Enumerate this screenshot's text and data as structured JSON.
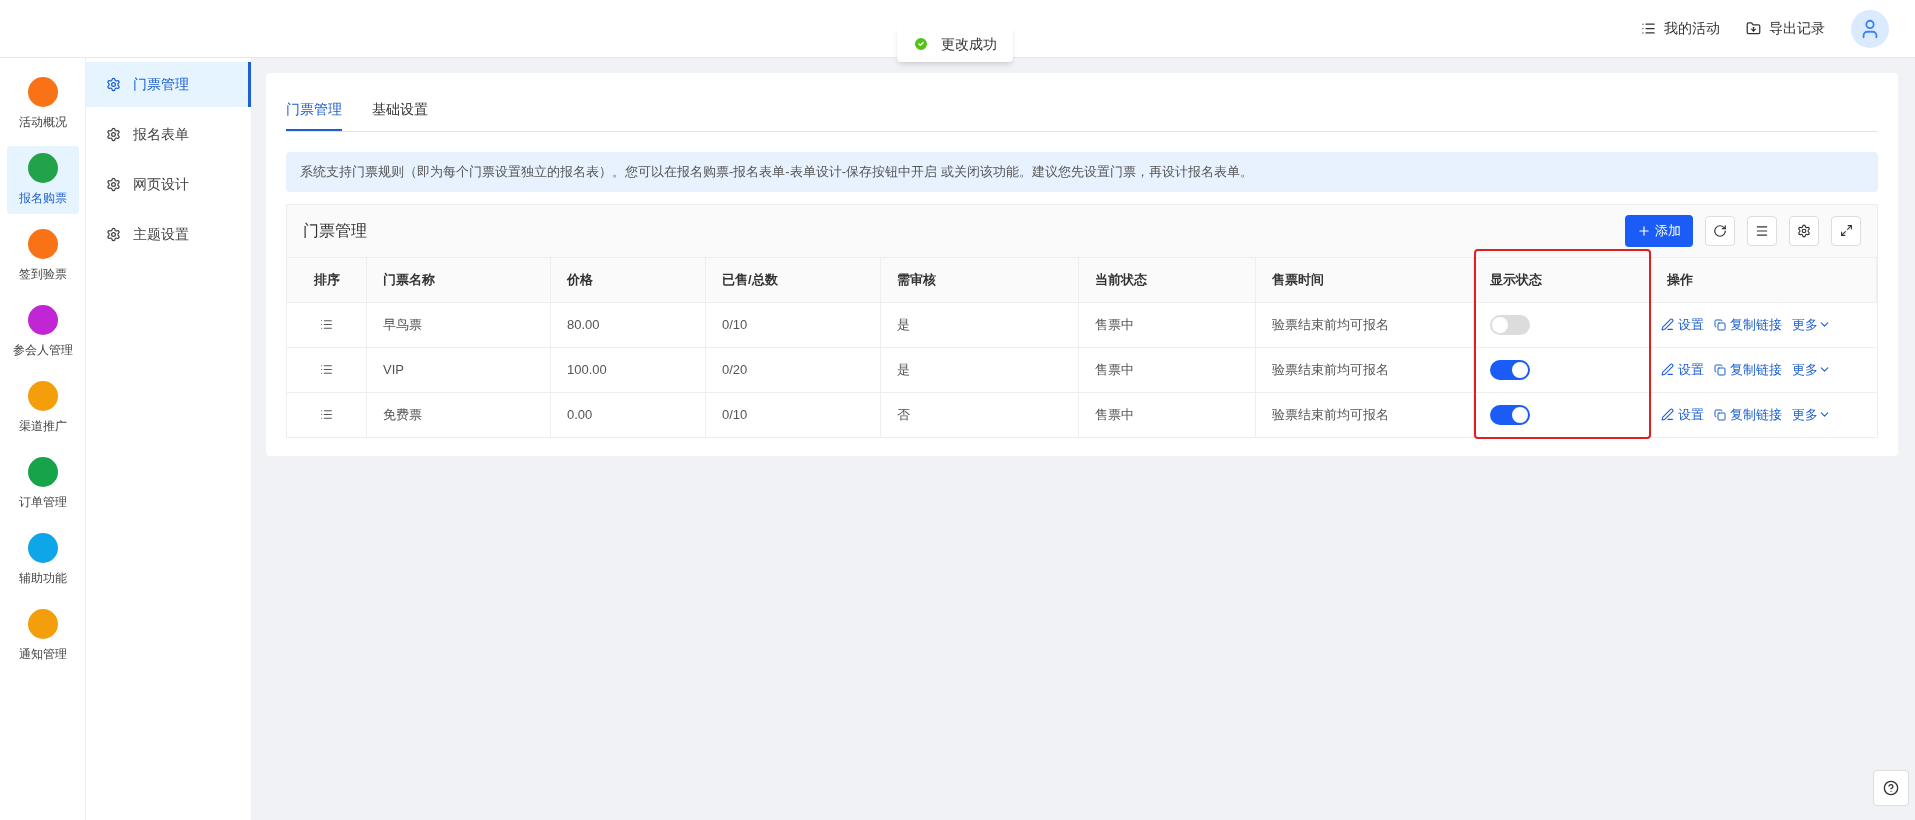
{
  "header": {
    "links": [
      {
        "label": "我的活动",
        "kind": "list"
      },
      {
        "label": "导出记录",
        "kind": "export"
      }
    ]
  },
  "toast": {
    "text": "更改成功"
  },
  "rail": [
    {
      "label": "活动概况",
      "color": "#f97316",
      "selected": false
    },
    {
      "label": "报名购票",
      "color": "#22a34a",
      "selected": true
    },
    {
      "label": "签到验票",
      "color": "#f97316",
      "selected": false
    },
    {
      "label": "参会人管理",
      "color": "#c026d3",
      "selected": false
    },
    {
      "label": "渠道推广",
      "color": "#f59e0b",
      "selected": false
    },
    {
      "label": "订单管理",
      "color": "#16a34a",
      "selected": false
    },
    {
      "label": "辅助功能",
      "color": "#0ea5e9",
      "selected": false
    },
    {
      "label": "通知管理",
      "color": "#f59e0b",
      "selected": false
    }
  ],
  "submenu": [
    {
      "label": "门票管理",
      "selected": true
    },
    {
      "label": "报名表单",
      "selected": false
    },
    {
      "label": "网页设计",
      "selected": false
    },
    {
      "label": "主题设置",
      "selected": false
    }
  ],
  "tabs": [
    {
      "label": "门票管理",
      "selected": true
    },
    {
      "label": "基础设置",
      "selected": false
    }
  ],
  "notice": "系统支持门票规则（即为每个门票设置独立的报名表）。您可以在报名购票-报名表单-表单设计-保存按钮中开启 或关闭该功能。建议您先设置门票，再设计报名表单。",
  "table": {
    "title": "门票管理",
    "add_button": "添加",
    "columns": [
      "排序",
      "门票名称",
      "价格",
      "已售/总数",
      "需审核",
      "当前状态",
      "售票时间",
      "显示状态",
      "操作"
    ],
    "rows": [
      {
        "name": "早鸟票",
        "price": "80.00",
        "sold": "0/10",
        "review": "是",
        "status": "售票中",
        "time": "验票结束前均可报名",
        "on": false,
        "actions": [
          "设置",
          "复制链接",
          "更多"
        ]
      },
      {
        "name": "VIP",
        "price": "100.00",
        "sold": "0/20",
        "review": "是",
        "status": "售票中",
        "time": "验票结束前均可报名",
        "on": true,
        "actions": [
          "设置",
          "复制链接",
          "更多"
        ]
      },
      {
        "name": "免费票",
        "price": "0.00",
        "sold": "0/10",
        "review": "否",
        "status": "售票中",
        "time": "验票结束前均可报名",
        "on": true,
        "actions": [
          "设置",
          "复制链接",
          "更多"
        ]
      }
    ]
  }
}
